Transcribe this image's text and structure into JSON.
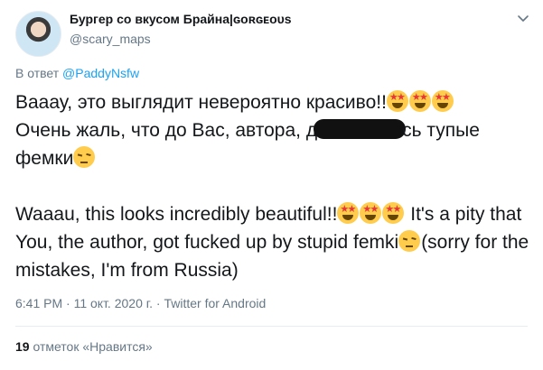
{
  "author": {
    "display_name": "Бургер со вкусом Брайна|ɢᴏʀɢᴇᴏᴜs",
    "handle": "@scary_maps"
  },
  "reply_to": {
    "prefix": "В ответ",
    "mention": "@PaddyNsfw"
  },
  "tweet": {
    "ru_line1": "Вааау, это выглядит невероятно красиво!!",
    "ru_line2_a": "Очень жаль, что до Вас, автора, д",
    "ru_line2_b": "сь тупые",
    "ru_line3": "фемки",
    "en_part1": "Waaau, this looks incredibly beautiful!!",
    "en_part2": " It's a pity that You, the author, got fucked up by stupid femki",
    "en_part3": "(sorry for the mistakes, I'm from Russia)"
  },
  "meta": {
    "text": "6:41 PM · 11 окт. 2020 г. · Twitter for Android"
  },
  "likes": {
    "count": "19",
    "label": "отметок «Нравится»"
  },
  "icons": {
    "star_struck": "star-struck-emoji",
    "pensive": "pensive-emoji",
    "chevron": "chevron-down-icon"
  },
  "colors": {
    "link": "#1da1f2",
    "secondary_text": "#657786",
    "primary_text": "#14171a"
  }
}
